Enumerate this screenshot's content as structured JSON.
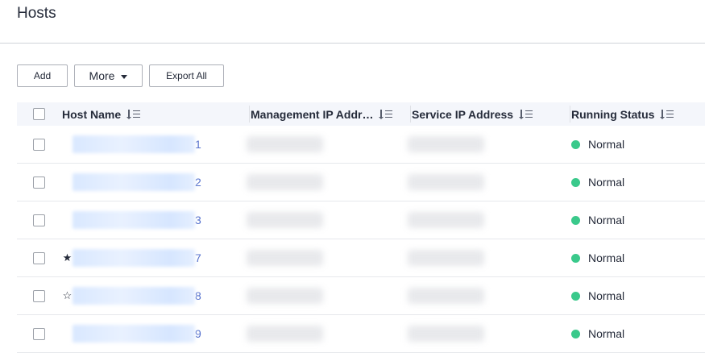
{
  "page": {
    "title": "Hosts"
  },
  "toolbar": {
    "add_label": "Add",
    "more_label": "More",
    "export_label": "Export All"
  },
  "table": {
    "columns": {
      "host_name": "Host Name",
      "mgmt_ip": "Management IP Addr…",
      "service_ip": "Service IP Address",
      "running_status": "Running Status"
    },
    "rows": [
      {
        "star": "",
        "host_suffix": "1",
        "status": "Normal"
      },
      {
        "star": "",
        "host_suffix": "2",
        "status": "Normal"
      },
      {
        "star": "",
        "host_suffix": "3",
        "status": "Normal"
      },
      {
        "star": "★",
        "host_suffix": "7",
        "status": "Normal"
      },
      {
        "star": "☆",
        "host_suffix": "8",
        "status": "Normal"
      },
      {
        "star": "",
        "host_suffix": "9",
        "status": "Normal"
      }
    ]
  },
  "colors": {
    "status_normal": "#3ac98b",
    "link": "#526ecc"
  }
}
